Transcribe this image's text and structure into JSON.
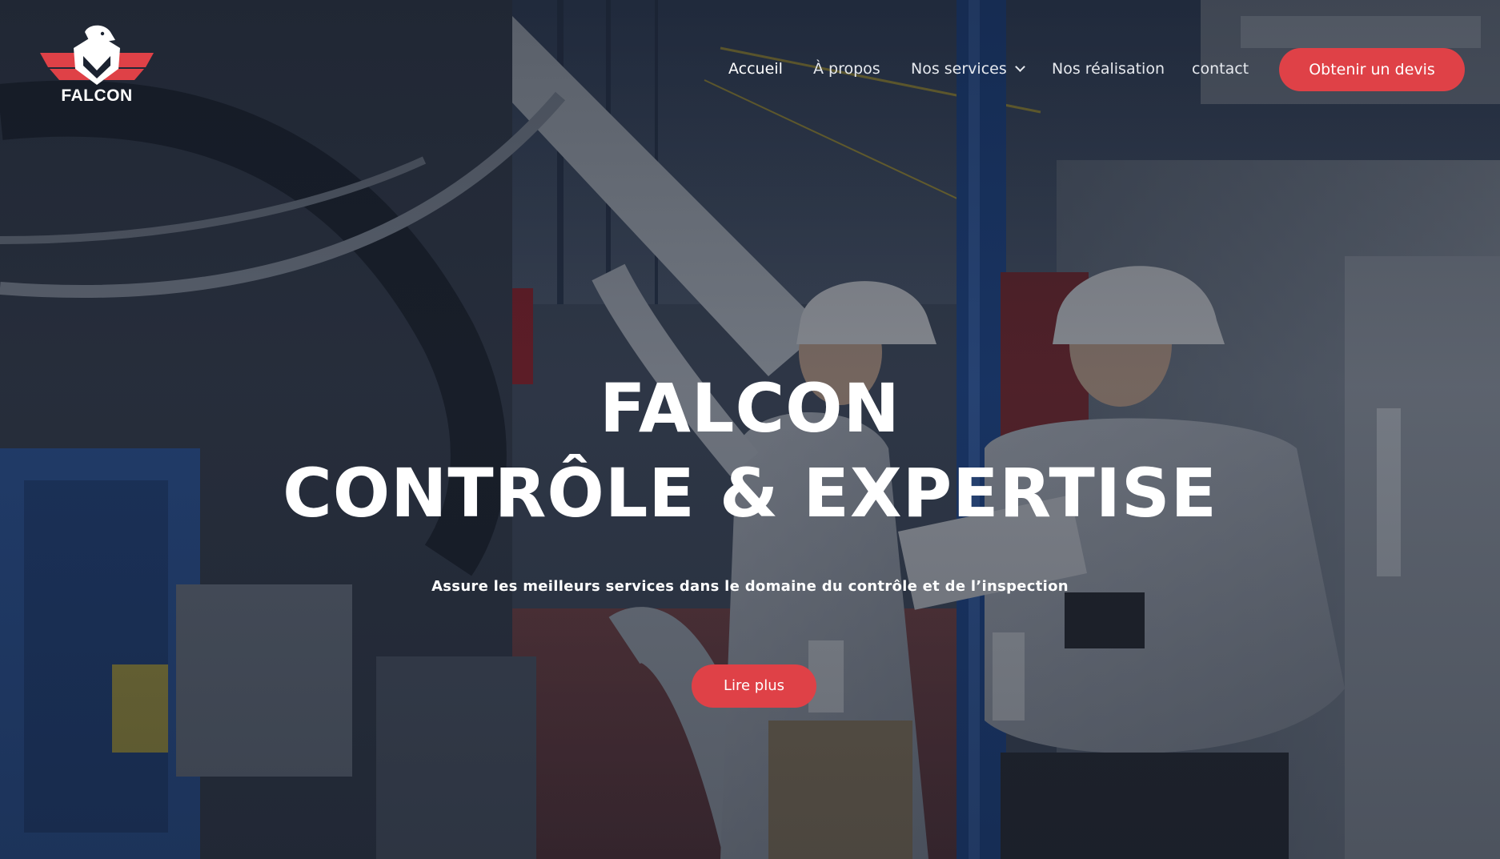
{
  "brand": {
    "name": "FALCON",
    "logo_icon": "falcon-eagle-shield-icon",
    "logo_colors": {
      "wings": "#df4147",
      "head": "#ffffff"
    }
  },
  "nav": {
    "items": [
      {
        "label": "Accueil",
        "active": true
      },
      {
        "label": "À propos",
        "active": false
      },
      {
        "label": "Nos services",
        "active": false,
        "has_dropdown": true,
        "dropdown_icon": "chevron-down-icon"
      },
      {
        "label": "Nos réalisation",
        "active": false
      },
      {
        "label": "contact",
        "active": false
      }
    ],
    "cta_label": "Obtenir un devis"
  },
  "hero": {
    "title_line1": "FALCON",
    "title_line2": "CONTRÔLE & EXPERTISE",
    "subtitle": "Assure les meilleurs services dans le domaine du contrôle et de l’inspection",
    "cta_label": "Lire plus"
  },
  "colors": {
    "accent": "#df4147",
    "overlay": "#101622",
    "text": "#ffffff"
  }
}
